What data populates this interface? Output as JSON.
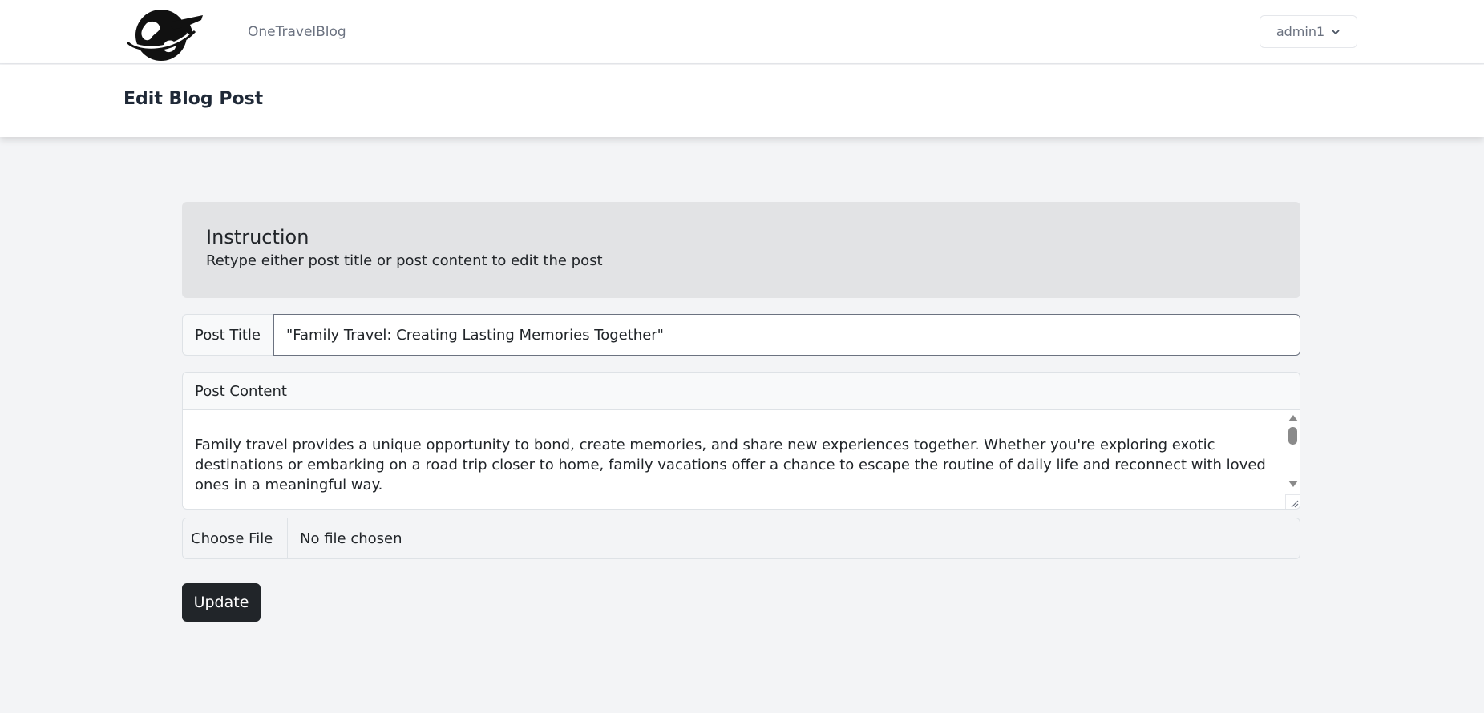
{
  "navbar": {
    "brand": "OneTravelBlog",
    "user": "admin1"
  },
  "header": {
    "title": "Edit Blog Post"
  },
  "instruction": {
    "title": "Instruction",
    "text": "Retype either post title or post content to edit the post"
  },
  "form": {
    "title_label": "Post Title",
    "title_value": "\"Family Travel: Creating Lasting Memories Together\"",
    "content_label": "Post Content",
    "content_value": "Family travel provides a unique opportunity to bond, create memories, and share new experiences together. Whether you're exploring exotic destinations or embarking on a road trip closer to home, family vacations offer a chance to escape the routine of daily life and reconnect with loved ones in a meaningful way.",
    "file_button": "Choose File",
    "file_status": "No file chosen",
    "submit_label": "Update"
  },
  "icons": {
    "logo": "globe-airplane-logo",
    "dropdown": "chevron-down-icon"
  },
  "colors": {
    "page_background": "#f3f4f6",
    "instruction_background": "#e2e3e5",
    "button_dark": "#212529"
  }
}
